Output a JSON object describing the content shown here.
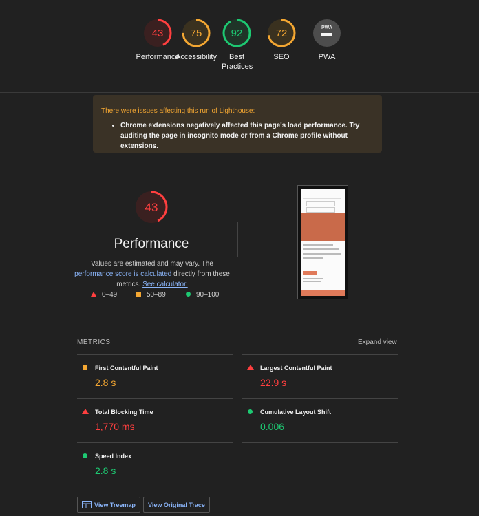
{
  "scores": [
    {
      "value": "43",
      "label": "Performance",
      "color": "#ff3f3f",
      "track": "#4a2222",
      "fraction": 0.43
    },
    {
      "value": "75",
      "label": "Accessibility",
      "color": "#f4a732",
      "track": "#4a3a1f",
      "fraction": 0.75
    },
    {
      "value": "92",
      "label": "Best Practices",
      "color": "#1dc972",
      "track": "#1e3b2a",
      "fraction": 0.92
    },
    {
      "value": "72",
      "label": "SEO",
      "color": "#f4a732",
      "track": "#4a3a1f",
      "fraction": 0.72
    },
    {
      "value": "PWA",
      "label": "PWA",
      "color": "#9e9e9e",
      "track": "#4d4d4d",
      "fraction": 0
    }
  ],
  "warning": {
    "title": "There were issues affecting this run of Lighthouse:",
    "item": "Chrome extensions negatively affected this page's load performance. Try auditing the page in incognito mode or from a Chrome profile without extensions."
  },
  "performance": {
    "score": "43",
    "title": "Performance",
    "desc_pre": "Values are estimated and may vary. The ",
    "link1": "performance score is calculated",
    "desc_mid": " directly from these metrics. ",
    "link2": "See calculator."
  },
  "legend": {
    "poor": "0–49",
    "average": "50–89",
    "good": "90–100"
  },
  "metrics": {
    "header": "METRICS",
    "expand": "Expand view",
    "fcp": {
      "name": "First Contentful Paint",
      "value": "2.8 s",
      "color": "#f4a732"
    },
    "lcp": {
      "name": "Largest Contentful Paint",
      "value": "22.9 s",
      "color": "#ff3f3f"
    },
    "tbt": {
      "name": "Total Blocking Time",
      "value": "1,770 ms",
      "color": "#ff3f3f"
    },
    "cls": {
      "name": "Cumulative Layout Shift",
      "value": "0.006",
      "color": "#1dc972"
    },
    "si": {
      "name": "Speed Index",
      "value": "2.8 s",
      "color": "#1dc972"
    }
  },
  "buttons": {
    "treemap": "View Treemap",
    "trace": "View Original Trace"
  }
}
